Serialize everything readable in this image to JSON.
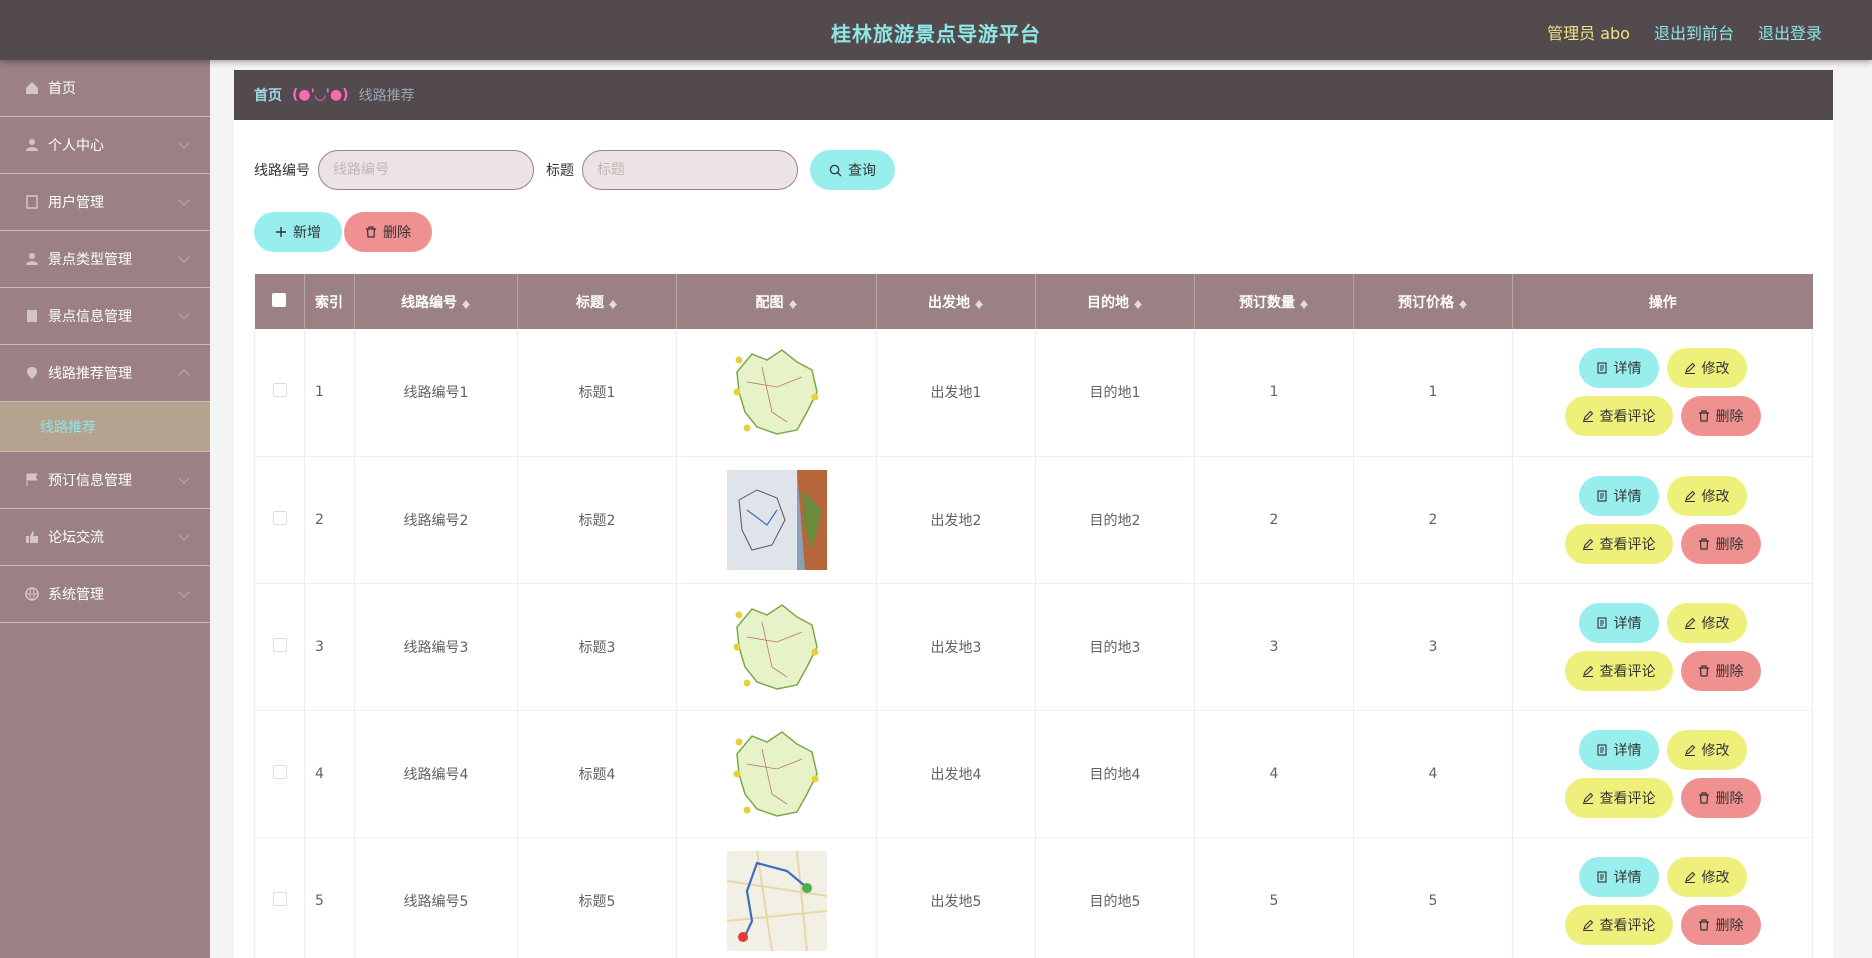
{
  "header": {
    "title": "桂林旅游景点导游平台",
    "admin": "管理员 abo",
    "to_front": "退出到前台",
    "logout": "退出登录"
  },
  "sidebar": {
    "items": [
      {
        "label": "首页",
        "icon": "home-icon"
      },
      {
        "label": "个人中心",
        "icon": "user-icon"
      },
      {
        "label": "用户管理",
        "icon": "doc-icon"
      },
      {
        "label": "景点类型管理",
        "icon": "user-icon"
      },
      {
        "label": "景点信息管理",
        "icon": "building-icon"
      },
      {
        "label": "线路推荐管理",
        "icon": "location-icon"
      },
      {
        "label": "预订信息管理",
        "icon": "flag-icon"
      },
      {
        "label": "论坛交流",
        "icon": "thumb-icon"
      },
      {
        "label": "系统管理",
        "icon": "globe-icon"
      }
    ],
    "sub_active": "线路推荐"
  },
  "breadcrumb": {
    "home": "首页",
    "sep": "(●'◡'●)",
    "current": "线路推荐"
  },
  "search": {
    "route_label": "线路编号",
    "route_placeholder": "线路编号",
    "title_label": "标题",
    "title_placeholder": "标题",
    "query": "查询"
  },
  "actions": {
    "add": "新增",
    "delete": "删除"
  },
  "table": {
    "headers": [
      "索引",
      "线路编号",
      "标题",
      "配图",
      "出发地",
      "目的地",
      "预订数量",
      "预订价格",
      "操作"
    ],
    "rows": [
      {
        "index": "1",
        "code": "线路编号1",
        "title": "标题1",
        "image": "map-green",
        "from": "出发地1",
        "to": "目的地1",
        "qty": "1",
        "price": "1"
      },
      {
        "index": "2",
        "code": "线路编号2",
        "title": "标题2",
        "image": "map-photo",
        "from": "出发地2",
        "to": "目的地2",
        "qty": "2",
        "price": "2"
      },
      {
        "index": "3",
        "code": "线路编号3",
        "title": "标题3",
        "image": "map-green",
        "from": "出发地3",
        "to": "目的地3",
        "qty": "3",
        "price": "3"
      },
      {
        "index": "4",
        "code": "线路编号4",
        "title": "标题4",
        "image": "map-green",
        "from": "出发地4",
        "to": "目的地4",
        "qty": "4",
        "price": "4"
      },
      {
        "index": "5",
        "code": "线路编号5",
        "title": "标题5",
        "image": "map-route",
        "from": "出发地5",
        "to": "目的地5",
        "qty": "5",
        "price": "5"
      }
    ],
    "ops": {
      "detail": "详情",
      "edit": "修改",
      "comments": "查看评论",
      "delete": "删除"
    }
  },
  "colors": {
    "topbar": "#524a4c",
    "sidebar": "#9b8183",
    "accent": "#8ee6e6",
    "cyan_btn": "#98eded",
    "red_btn": "#f09191",
    "yellow_btn": "#eef07b"
  }
}
